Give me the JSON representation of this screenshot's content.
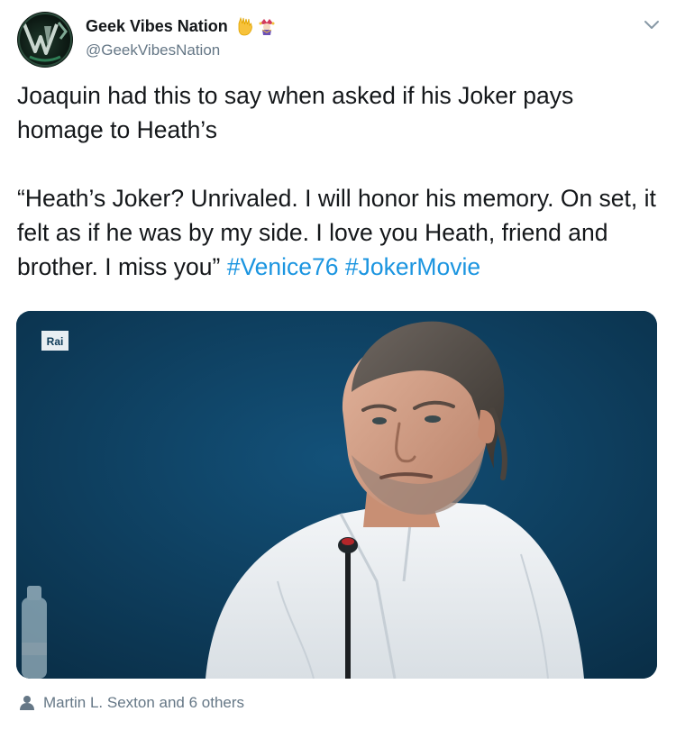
{
  "author": {
    "display_name": "Geek Vibes Nation",
    "username": "@GeekVibesNation",
    "avatar_icon": "gvn-logo-icon",
    "badges": [
      "vulcan-salute-icon",
      "jester-icon"
    ]
  },
  "tweet": {
    "paragraph1": "Joaquin had this to say when asked if his Joker pays homage to Heath’s",
    "paragraph2": "“Heath’s Joker? Unrivaled. I will honor his memory. On set, it felt as if he was by my side. I love you Heath, friend and brother. I miss you”",
    "hashtags": [
      "#Venice76",
      "#JokerMovie"
    ]
  },
  "media": {
    "watermark": "Rai",
    "alt_subject": "man-at-press-conference-with-microphone"
  },
  "footer": {
    "liked_by": "Martin L. Sexton and 6 others"
  },
  "colors": {
    "link": "#1b95e0",
    "secondary_text": "#657786",
    "primary_text": "#14171a",
    "media_background": "#0d3a57"
  }
}
